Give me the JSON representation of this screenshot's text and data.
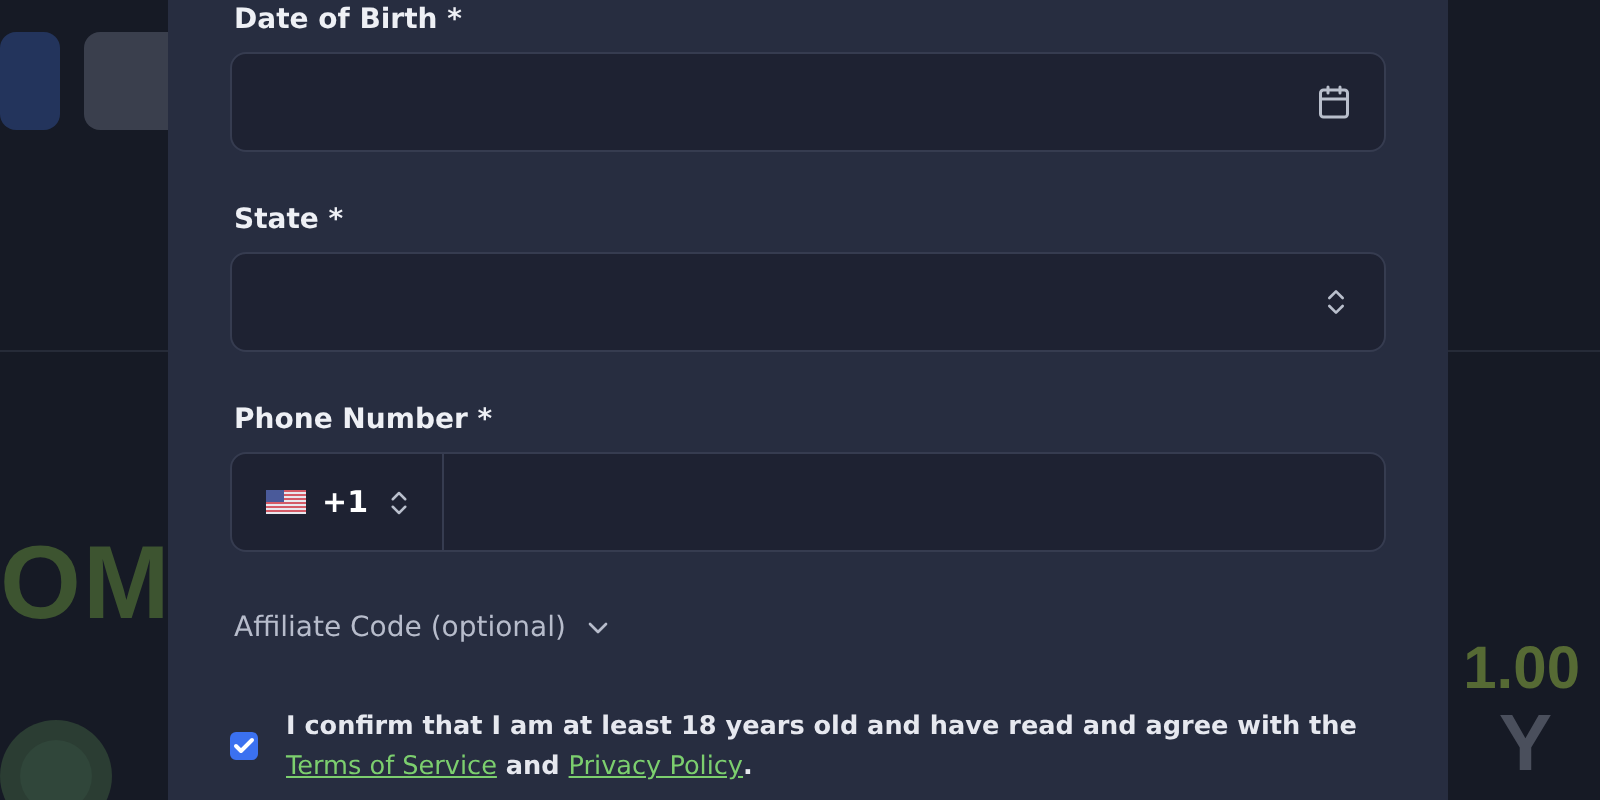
{
  "background": {
    "promo_text": "OM",
    "amount": "1.00",
    "letter": "Y"
  },
  "form": {
    "fields": [
      {
        "kind": "date",
        "label": "Date of Birth *"
      },
      {
        "kind": "select",
        "label": "State *"
      },
      {
        "kind": "phone",
        "label": "Phone Number *",
        "country_code": "+1"
      }
    ],
    "affiliate": {
      "label": "Affiliate Code (optional)",
      "expanded": false
    },
    "consent": {
      "checked": true,
      "text": "I confirm that I am at least 18 years old and have read and agree with the",
      "terms_link": "Terms of Service",
      "joiner": "and",
      "privacy_link": "Privacy Policy",
      "end": "."
    }
  }
}
